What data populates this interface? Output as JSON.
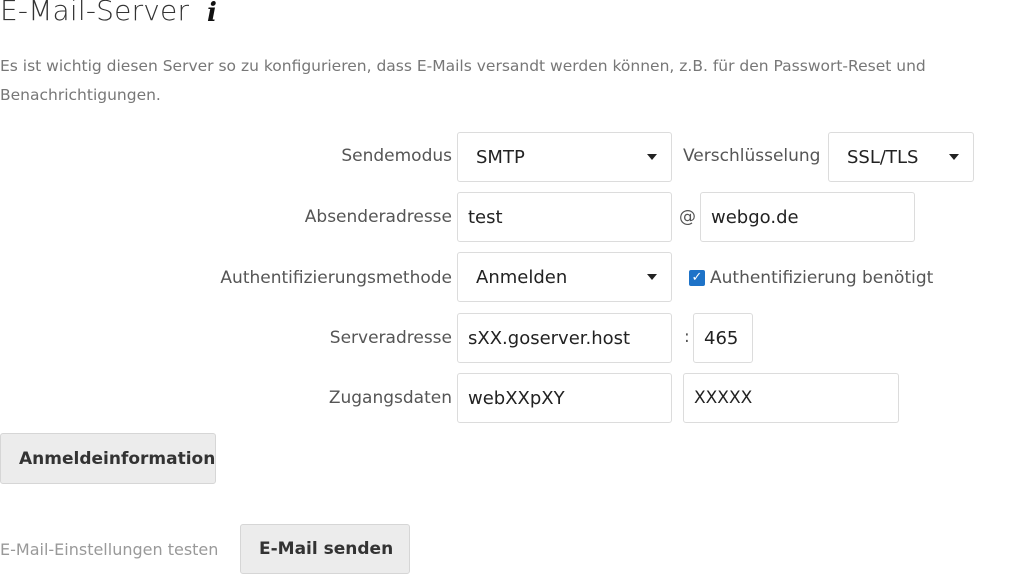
{
  "page": {
    "title": "E-Mail-Server",
    "info_icon": "i",
    "description": "Es ist wichtig diesen Server so zu konfigurieren, dass E-Mails versandt werden können, z.B. für den Passwort-Reset und Benachrichtigungen."
  },
  "form": {
    "send_mode": {
      "label": "Sendemodus",
      "value": "SMTP"
    },
    "encryption": {
      "label": "Verschlüsselung",
      "value": "SSL/TLS"
    },
    "sender_address": {
      "label": "Absenderadresse",
      "local_part": "test",
      "at": "@",
      "domain": "webgo.de"
    },
    "auth_method": {
      "label": "Authentifizierungsmethode",
      "value": "Anmelden",
      "auth_required_label": "Authentifizierung benötigt",
      "auth_required_checked": true
    },
    "server_address": {
      "label": "Serveradresse",
      "host": "sXX.goserver.host",
      "colon": ":",
      "port": "465"
    },
    "credentials": {
      "label": "Zugangsdaten",
      "username": "webXXpXY",
      "password": "XXXXX"
    }
  },
  "buttons": {
    "store_credentials": "Anmeldeinformationen speichern",
    "send_email": "E-Mail senden"
  },
  "test": {
    "label": "E-Mail-Einstellungen testen"
  },
  "colors": {
    "checkbox_accent": "#1e73c8",
    "button_bg": "#ececec"
  }
}
